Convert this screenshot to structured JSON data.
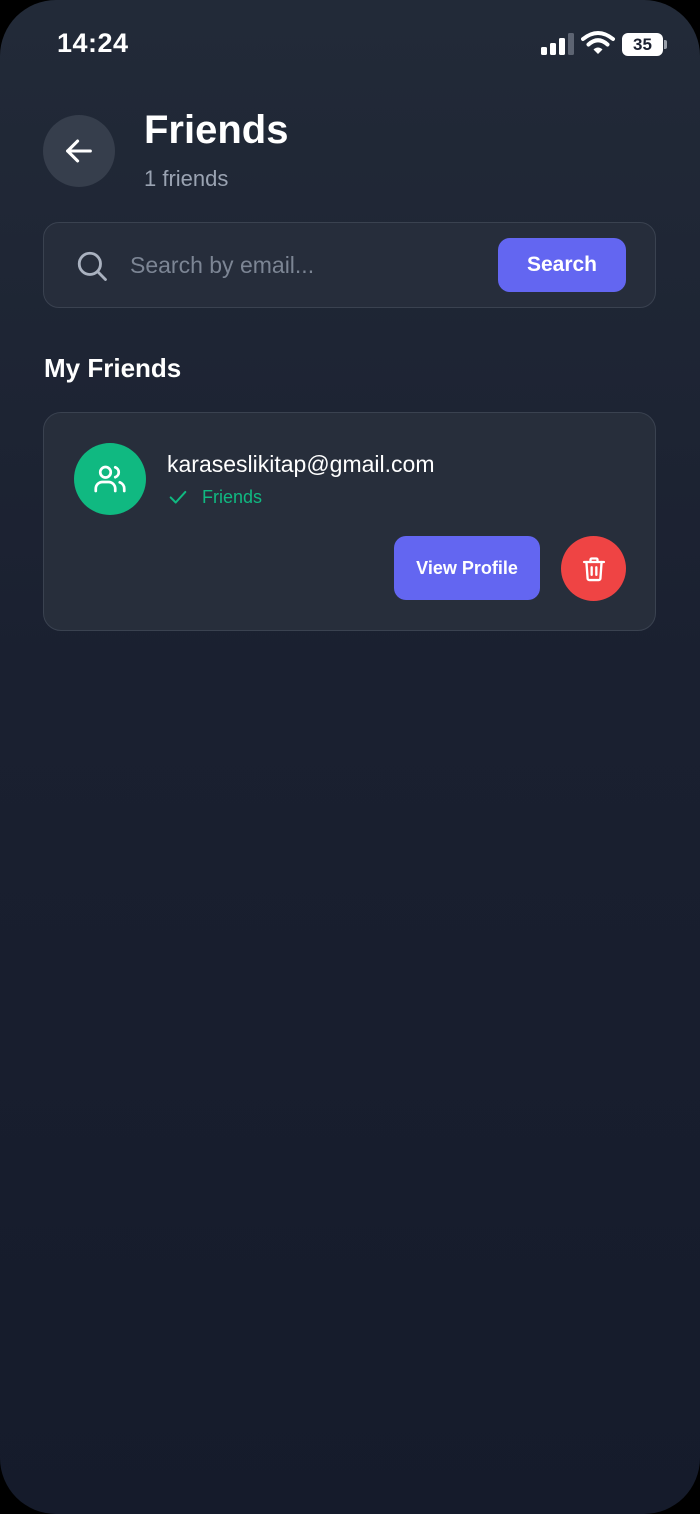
{
  "status_bar": {
    "time": "14:24",
    "battery_level": "35",
    "signal_icon": "cellular-signal-icon",
    "wifi_icon": "wifi-icon",
    "battery_icon": "battery-icon"
  },
  "header": {
    "back_icon": "arrow-left-icon",
    "title": "Friends",
    "subtitle": "1 friends"
  },
  "search": {
    "icon": "search-icon",
    "placeholder": "Search by email...",
    "value": "",
    "button_label": "Search"
  },
  "section": {
    "title": "My Friends"
  },
  "friends": [
    {
      "email": "karaseslikitap@gmail.com",
      "status": "Friends",
      "avatar_icon": "users-icon",
      "status_icon": "check-icon",
      "view_profile_label": "View Profile",
      "delete_icon": "trash-icon"
    }
  ],
  "colors": {
    "accent": "#6366f1",
    "success": "#10b981",
    "danger": "#ef4444",
    "background": "#1a2030",
    "card": "#272e3b"
  }
}
